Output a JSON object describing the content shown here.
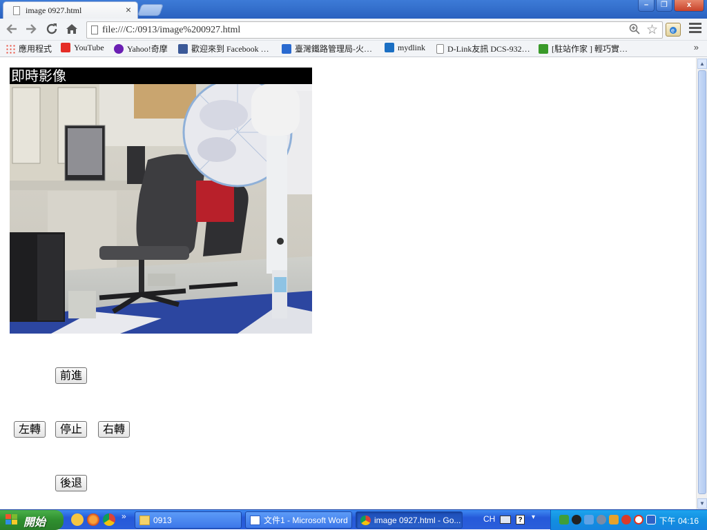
{
  "browser": {
    "tab_title": "image 0927.html",
    "tab_close": "×",
    "url": "file:///C:/0913/image%200927.html",
    "window_buttons": {
      "minimize": "–",
      "restore": "❐",
      "close": "x"
    }
  },
  "bookmarks": [
    {
      "label": "應用程式",
      "color": "#e84d3d"
    },
    {
      "label": "YouTube",
      "color": "#e52d27"
    },
    {
      "label": "Yahoo!奇摩",
      "color": "#6b1fb3"
    },
    {
      "label": "歡迎來到 Facebook …",
      "color": "#3b5998"
    },
    {
      "label": "臺灣鐵路管理局-火…",
      "color": "#2a6ad0"
    },
    {
      "label": "mydlink",
      "color": "#1b6fc3"
    },
    {
      "label": "D-Link友訊 DCS-932…",
      "color": "#ffffff"
    },
    {
      "label": "[駐站作家 ] 輕巧實…",
      "color": "#3a9a2a"
    }
  ],
  "bookmarks_more": "»",
  "page": {
    "video_label": "即時影像",
    "controls": {
      "forward": "前進",
      "left": "左轉",
      "stop": "停止",
      "right": "右轉",
      "backward": "後退"
    }
  },
  "taskbar": {
    "start_label": "開始",
    "quicklaunch_more": "»",
    "tasks": [
      {
        "label": "0913",
        "active": false
      },
      {
        "label": "文件1 - Microsoft Word",
        "active": false
      },
      {
        "label": "image 0927.html - Go...",
        "active": true
      }
    ],
    "language": "CH",
    "clock": "下午 04:16"
  }
}
